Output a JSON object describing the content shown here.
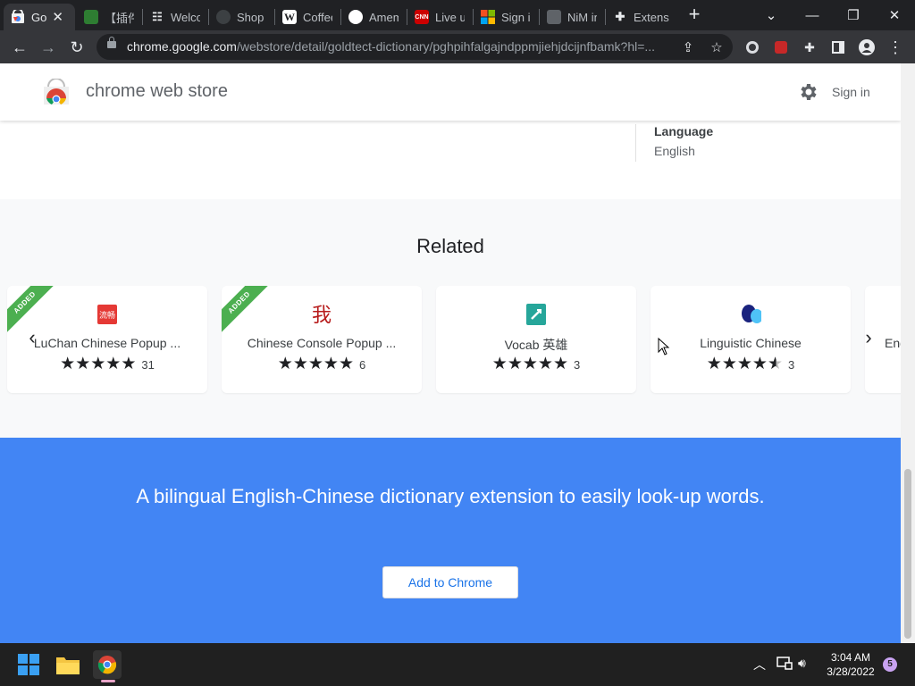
{
  "browser": {
    "tabs": [
      {
        "title": "Go",
        "favicon": "chrome-webstore-icon",
        "color": "#e8eaed",
        "active": true
      },
      {
        "title": "【插件】",
        "favicon": "green-hand-icon",
        "color": "#2e7d32"
      },
      {
        "title": "Welco",
        "favicon": "grid-logo-icon",
        "color": "#e8eaed"
      },
      {
        "title": "Shop",
        "favicon": "globe-icon",
        "color": "#9aa0a6"
      },
      {
        "title": "Coffee",
        "favicon": "wikipedia-icon",
        "color": "#ffffff"
      },
      {
        "title": "Amem",
        "favicon": "circle-logo-icon",
        "color": "#ffffff"
      },
      {
        "title": "Live up",
        "favicon": "cnn-icon",
        "color": "#cc0000"
      },
      {
        "title": "Sign in",
        "favicon": "microsoft-icon",
        "color": "#f25022"
      },
      {
        "title": "NiM in",
        "favicon": "nim-icon",
        "color": "#9aa0a6"
      },
      {
        "title": "Extens",
        "favicon": "puzzle-icon",
        "color": "#e8eaed"
      }
    ],
    "url_host": "chrome.google.com",
    "url_path": "/webstore/detail/goldtect-dictionary/pghpihfalgajndppmjiehjdcijnfbamk?hl=..."
  },
  "header": {
    "title": "chrome web store",
    "signin_label": "Sign in"
  },
  "details": {
    "language_label": "Language",
    "language_value": "English"
  },
  "related": {
    "title": "Related",
    "cards": [
      {
        "name": "LuChan Chinese Popup ...",
        "stars": 5,
        "count": "31",
        "added": true,
        "icon": "luchan-icon",
        "icon_color": "#e53935"
      },
      {
        "name": "Chinese Console Popup ...",
        "stars": 5,
        "count": "6",
        "added": true,
        "icon": "chinese-char-icon",
        "icon_color": "#b71c1c"
      },
      {
        "name": "Vocab 英雄",
        "stars": 5,
        "count": "3",
        "added": false,
        "icon": "vocab-icon",
        "icon_color": "#26a69a"
      },
      {
        "name": "Linguistic Chinese",
        "stars": 4.5,
        "count": "3",
        "added": false,
        "icon": "speech-bubbles-icon",
        "icon_color": "#1a237e"
      },
      {
        "name": "Eng",
        "stars": 0,
        "count": "",
        "added": false,
        "icon": "",
        "icon_color": ""
      }
    ],
    "added_label": "ADDED"
  },
  "cta": {
    "description": "A bilingual English-Chinese dictionary extension to easily look-up words.",
    "button_label": "Add to Chrome",
    "background": "#4285f4"
  },
  "taskbar": {
    "time": "3:04 AM",
    "date": "3/28/2022",
    "notification_count": "5"
  }
}
